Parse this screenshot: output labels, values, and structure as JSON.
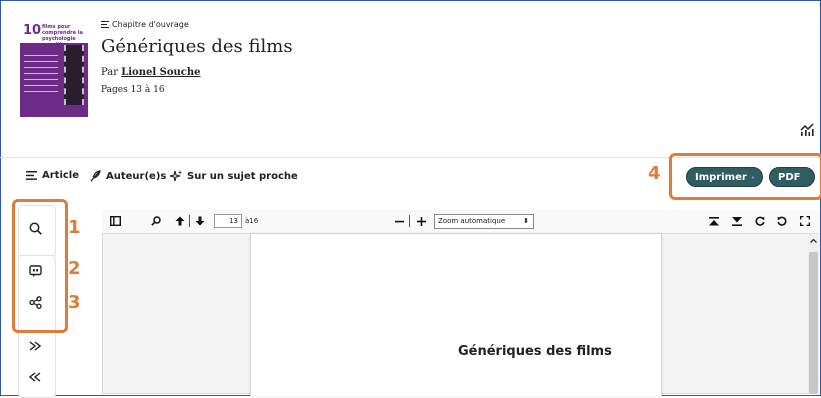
{
  "book": {
    "cover_number": "10",
    "cover_subtitle": "films pour comprendre la psychologie cognitive"
  },
  "header": {
    "chapter_label": "Chapitre d'ouvrage",
    "title": "Génériques des films",
    "by_prefix": "Par",
    "author": "Lionel Souche",
    "pages": "Pages 13 à 16"
  },
  "tabs": [
    {
      "label": "Article",
      "icon": "list-icon"
    },
    {
      "label": "Auteur(e)s",
      "icon": "quill-icon"
    },
    {
      "label": "Sur un sujet proche",
      "icon": "sparkle-icon"
    }
  ],
  "actions": {
    "print_label": "Imprimer",
    "pdf_label": "PDF"
  },
  "annotations": {
    "n1": "1",
    "n2": "2",
    "n3": "3",
    "n4": "4"
  },
  "viewer": {
    "page_value": "13",
    "page_of": "à16",
    "zoom_label": "Zoom automatique",
    "page_heading": "Génériques des films"
  },
  "colors": {
    "highlight": "#e07b39",
    "button": "#2f5d62",
    "cover": "#6b2b86"
  }
}
